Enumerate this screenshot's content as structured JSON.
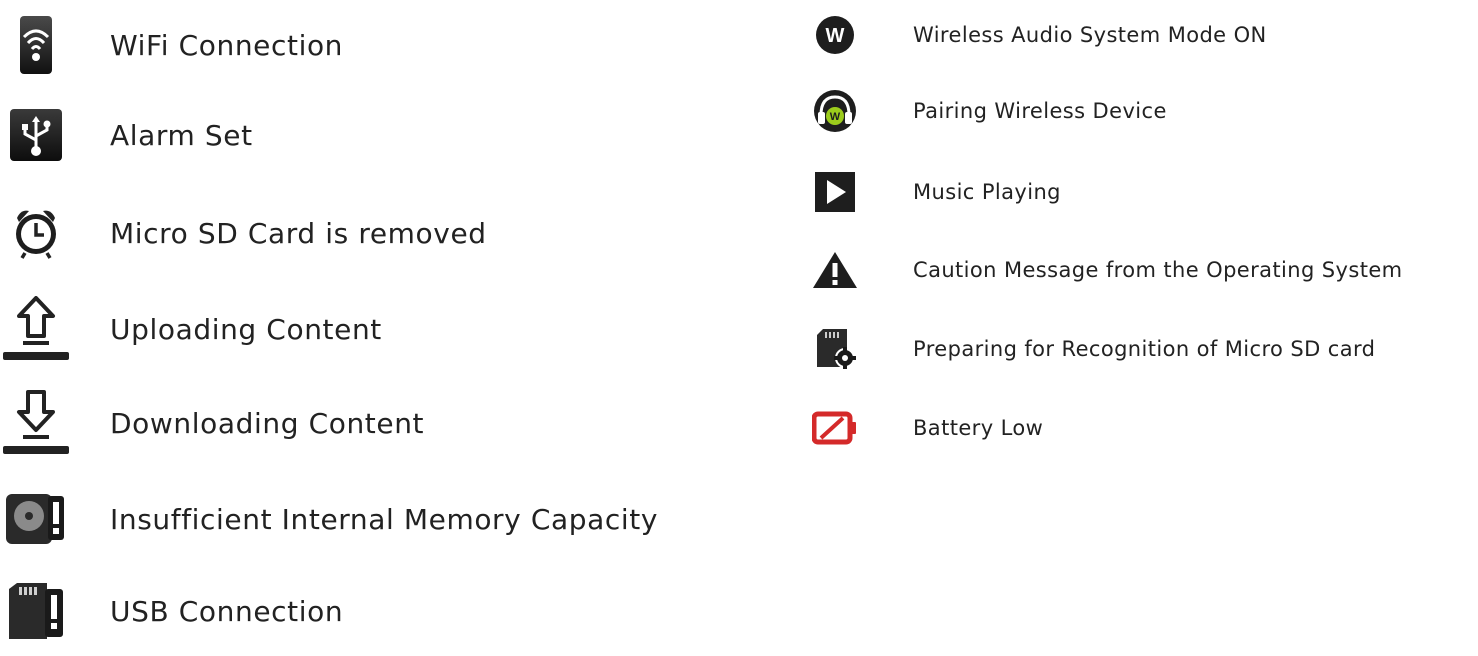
{
  "left_column": {
    "items": [
      {
        "icon": "wifi-icon",
        "label": "WiFi Connection"
      },
      {
        "icon": "usb-icon",
        "label": "Alarm Set"
      },
      {
        "icon": "alarm-clock-icon",
        "label": "Micro SD Card is removed"
      },
      {
        "icon": "upload-icon",
        "label": "Uploading Content"
      },
      {
        "icon": "download-icon",
        "label": "Downloading Content"
      },
      {
        "icon": "memory-warning-icon",
        "label": "Insufficient Internal Memory Capacity"
      },
      {
        "icon": "sd-card-warning-icon",
        "label": "USB Connection"
      }
    ]
  },
  "right_column": {
    "items": [
      {
        "icon": "wireless-audio-icon",
        "label": "Wireless Audio System Mode ON"
      },
      {
        "icon": "headphones-pairing-icon",
        "label": "Pairing Wireless Device"
      },
      {
        "icon": "play-icon",
        "label": "Music Playing"
      },
      {
        "icon": "caution-icon",
        "label": "Caution Message from the Operating System"
      },
      {
        "icon": "sd-card-preparing-icon",
        "label": "Preparing for Recognition of Micro SD card"
      },
      {
        "icon": "battery-low-icon",
        "label": "Battery Low"
      }
    ]
  },
  "colors": {
    "text": "#222222",
    "icon_dark": "#1a1a1a",
    "accent_green": "#9ccc1c",
    "battery_red": "#d42a2a"
  }
}
